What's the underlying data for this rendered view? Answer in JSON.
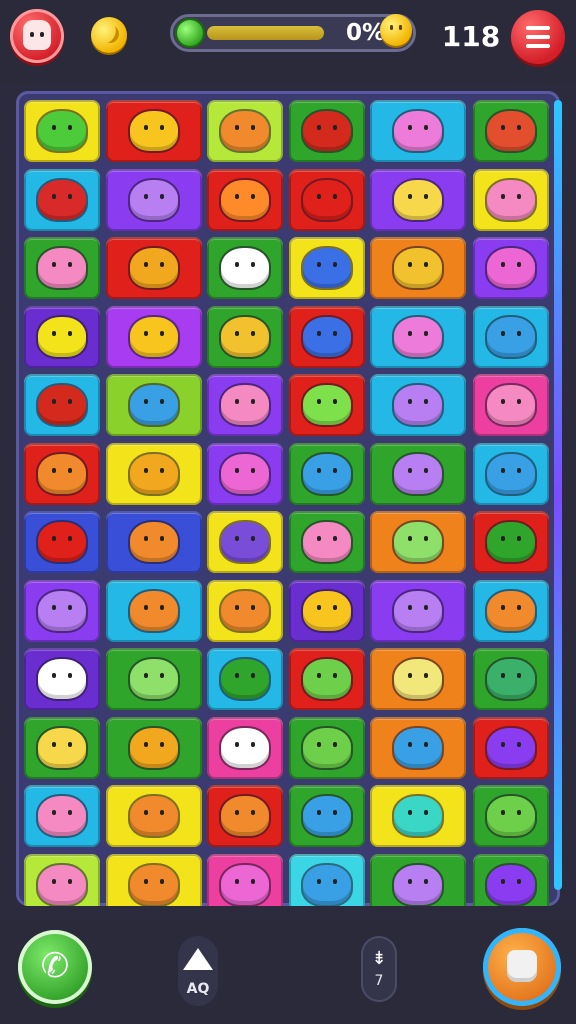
{
  "header": {
    "score": "118",
    "progress_text": "0%",
    "progress_value": 0.45
  },
  "icons": {
    "avatar": "avatar-icon",
    "coin": "coin-icon",
    "progress": "green-gem-icon",
    "star": "smiley-star-icon",
    "menu": "hamburger-menu-icon",
    "call": "phone-icon",
    "up": "triangle-up-icon",
    "down": "down-arrow-icon",
    "bag": "bag-icon"
  },
  "controls": {
    "up_label": "AQ",
    "down_label": "7"
  },
  "board": {
    "rows": 12,
    "cols": 6,
    "tiles": [
      [
        "#f2e31a",
        "#e0201b",
        "#b6e83a",
        "#2fa52b",
        "#24b8e6",
        "#2fa52b"
      ],
      [
        "#24b8e6",
        "#8a3cf0",
        "#e0201b",
        "#e0201b",
        "#8a3cf0",
        "#f2e31a"
      ],
      [
        "#2fa52b",
        "#e0201b",
        "#2fa52b",
        "#f2e31a",
        "#f0821c",
        "#8a3cf0"
      ],
      [
        "#6a2ed0",
        "#a73cf0",
        "#2fa52b",
        "#e0201b",
        "#24b8e6",
        "#24b8e6"
      ],
      [
        "#24b8e6",
        "#8ad12b",
        "#8a3cf0",
        "#e0201b",
        "#24b8e6",
        "#ec3fa0"
      ],
      [
        "#e0201b",
        "#f2e31a",
        "#8a3cf0",
        "#2fa52b",
        "#2fa52b",
        "#24b8e6"
      ],
      [
        "#3a4fd8",
        "#3a4fd8",
        "#f2e31a",
        "#2fa52b",
        "#f0821c",
        "#e0201b"
      ],
      [
        "#8a3cf0",
        "#24b8e6",
        "#f2e31a",
        "#6a2ed0",
        "#8a3cf0",
        "#24b8e6"
      ],
      [
        "#6a2ed0",
        "#2fa52b",
        "#24b8e6",
        "#e0201b",
        "#f0821c",
        "#2fa52b"
      ],
      [
        "#2fa52b",
        "#2fa52b",
        "#ec3fa0",
        "#2fa52b",
        "#f0821c",
        "#e0201b"
      ],
      [
        "#24b8e6",
        "#f2e31a",
        "#e0201b",
        "#2fa52b",
        "#f2e31a",
        "#2fa52b"
      ],
      [
        "#b6e83a",
        "#f2e31a",
        "#ec3fa0",
        "#3ad6e6",
        "#2fa52b",
        "#2fa52b"
      ]
    ],
    "creatures": [
      [
        "#4ecb3a",
        "#f7c51e",
        "#f08a2c",
        "#d42a1e",
        "#ec7bd9",
        "#e34f2e"
      ],
      [
        "#d92a2a",
        "#b77ff2",
        "#ff8a2a",
        "#e0201b",
        "#f7d84a",
        "#f58ac3"
      ],
      [
        "#f58ac3",
        "#f2a81e",
        "#ffffff",
        "#3a6fe6",
        "#f2c12e",
        "#ec67d3"
      ],
      [
        "#f2e31a",
        "#f7c51e",
        "#f2c12e",
        "#3a6fe6",
        "#ec7bd9",
        "#3aa0e6"
      ],
      [
        "#d42a1e",
        "#3aa0e6",
        "#f58ac3",
        "#7ee04a",
        "#b77ff2",
        "#f58ac3"
      ],
      [
        "#f08a2c",
        "#f2a81e",
        "#ec67d3",
        "#3aa0e6",
        "#b77ff2",
        "#3aa0e6"
      ],
      [
        "#e0201b",
        "#f08a2c",
        "#7a4dd8",
        "#f58ac3",
        "#8ee06a",
        "#2fa52b"
      ],
      [
        "#b77ff2",
        "#f08a2c",
        "#f08a2c",
        "#f7c51e",
        "#b77ff2",
        "#f08a2c"
      ],
      [
        "#ffffff",
        "#8ee06a",
        "#2fa52b",
        "#6ed04a",
        "#f2e77a",
        "#3ab06a"
      ],
      [
        "#f7d84a",
        "#f2a81e",
        "#ffffff",
        "#6ed04a",
        "#3aa0e6",
        "#8a3cf0"
      ],
      [
        "#f58ac3",
        "#f08a2c",
        "#f08a2c",
        "#3aa0e6",
        "#3ad6c6",
        "#6ed04a"
      ],
      [
        "#f58ac3",
        "#f08a2c",
        "#ec67d3",
        "#3aa0e6",
        "#b77ff2",
        "#8a3cf0"
      ]
    ]
  }
}
